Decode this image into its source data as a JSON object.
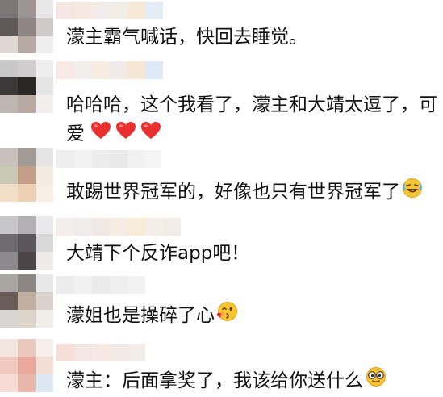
{
  "comments": [
    {
      "text": "濛主霸气喊话，快回去睡觉。",
      "emoji": []
    },
    {
      "text_line1": "哈哈哈，这个我看了，濛主和大靖太逗了，可",
      "text_line2": "爱",
      "emoji": [
        "red-heart",
        "red-heart",
        "red-heart"
      ]
    },
    {
      "text": "敢踢世界冠军的，好像也只有世界冠军了",
      "emoji": [
        "laughing-crying-face"
      ]
    },
    {
      "text": "大靖下个反诈app吧！",
      "emoji": []
    },
    {
      "text": "濛姐也是操碎了心",
      "emoji": [
        "blowing-kiss-face"
      ]
    },
    {
      "text": "濛主：后面拿奖了，我该给你送什么",
      "emoji": [
        "nerd-glasses-face"
      ]
    }
  ],
  "colors": {
    "text": "#111111",
    "background": "#ffffff",
    "heart": "#e8312f",
    "emoji_face": "#f7c531"
  }
}
